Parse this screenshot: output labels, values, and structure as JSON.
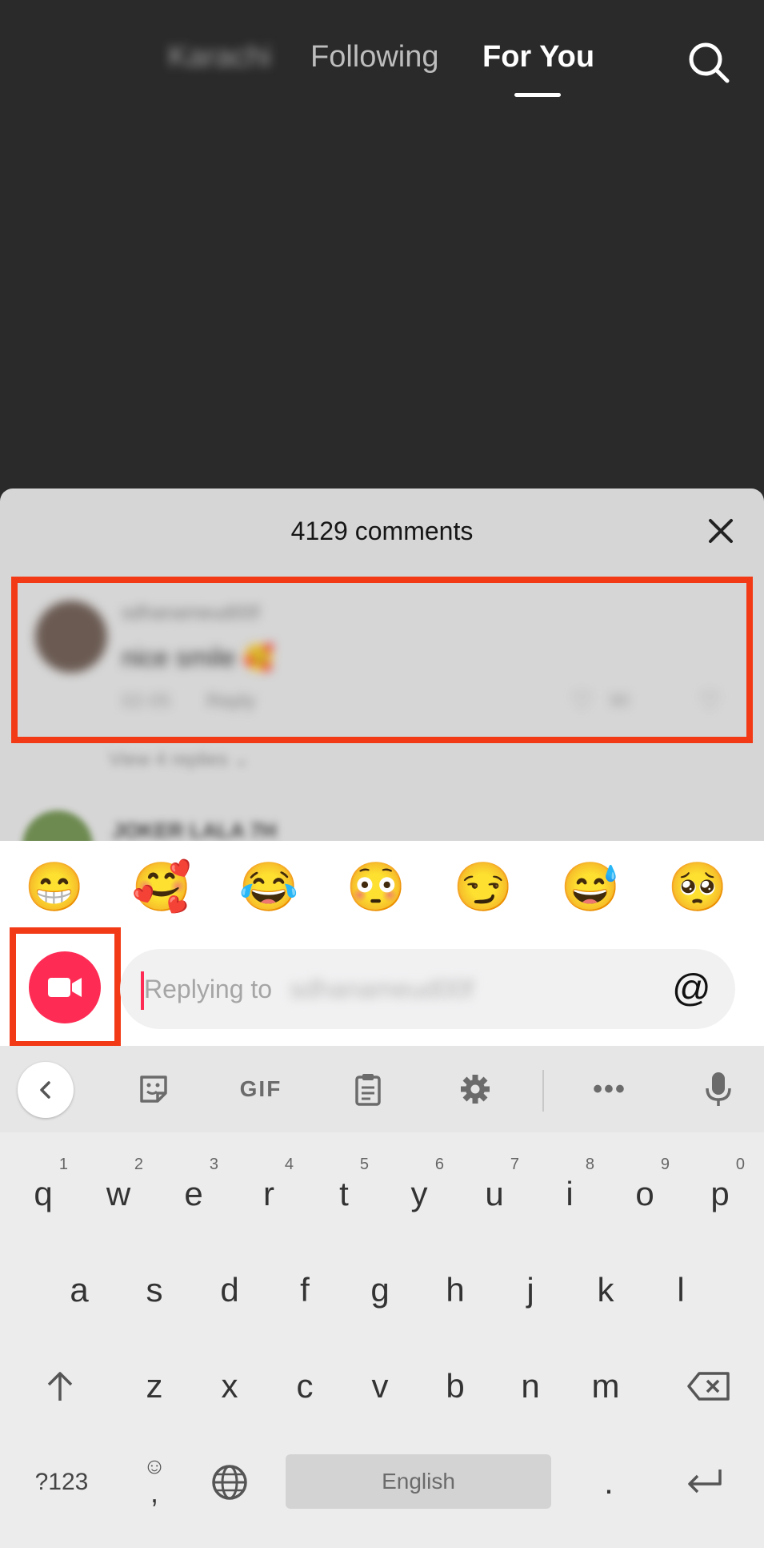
{
  "top_nav": {
    "location_tab": "Karachi",
    "following_tab": "Following",
    "foryou_tab": "For You"
  },
  "comments_sheet": {
    "title": "4129 comments",
    "highlighted_comment": {
      "username": "sdhanameud00f",
      "text": "nice smile 🥰",
      "time": "02-05",
      "reply_label": "Reply",
      "like_count": "90"
    },
    "view_replies": "View 4 replies ⌄",
    "next_comment_username": "JOKER LALA 7H"
  },
  "composer": {
    "emojis": [
      "😁",
      "🥰",
      "😂",
      "😳",
      "😏",
      "😅",
      "🥺"
    ],
    "placeholder_prefix": "Replying to",
    "placeholder_name": "sdhanameud00f",
    "mention_symbol": "@"
  },
  "keyboard": {
    "toolbar": {
      "gif_label": "GIF",
      "more_label": "•••"
    },
    "row1": [
      {
        "key": "q",
        "hint": "1"
      },
      {
        "key": "w",
        "hint": "2"
      },
      {
        "key": "e",
        "hint": "3"
      },
      {
        "key": "r",
        "hint": "4"
      },
      {
        "key": "t",
        "hint": "5"
      },
      {
        "key": "y",
        "hint": "6"
      },
      {
        "key": "u",
        "hint": "7"
      },
      {
        "key": "i",
        "hint": "8"
      },
      {
        "key": "o",
        "hint": "9"
      },
      {
        "key": "p",
        "hint": "0"
      }
    ],
    "row2": [
      "a",
      "s",
      "d",
      "f",
      "g",
      "h",
      "j",
      "k",
      "l"
    ],
    "row3": [
      "z",
      "x",
      "c",
      "v",
      "b",
      "n",
      "m"
    ],
    "symbols_key": "?123",
    "emoji_key_top": "☺",
    "emoji_key_bottom": ",",
    "space_label": "English",
    "period_key": "."
  },
  "colors": {
    "accent_pink": "#fe2c55",
    "highlight_red": "#f23a17"
  }
}
